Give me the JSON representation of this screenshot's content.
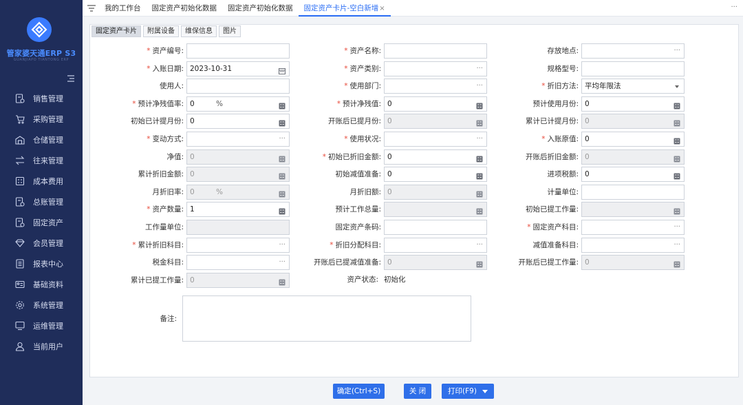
{
  "app": {
    "brand": "管家婆天通ERP S3",
    "brand_sub": "GUANJIAPO TIANTONG ERP"
  },
  "sidebar": {
    "items": [
      {
        "label": "销售管理",
        "icon": "sales-doc-icon"
      },
      {
        "label": "采购管理",
        "icon": "cart-icon"
      },
      {
        "label": "仓储管理",
        "icon": "warehouse-icon"
      },
      {
        "label": "往来管理",
        "icon": "exchange-icon"
      },
      {
        "label": "成本费用",
        "icon": "calculator-icon"
      },
      {
        "label": "总账管理",
        "icon": "ledger-icon"
      },
      {
        "label": "固定资产",
        "icon": "asset-icon"
      },
      {
        "label": "会员管理",
        "icon": "diamond-icon"
      },
      {
        "label": "报表中心",
        "icon": "report-icon"
      },
      {
        "label": "基础资料",
        "icon": "id-card-icon"
      },
      {
        "label": "系统管理",
        "icon": "gear-icon"
      },
      {
        "label": "运维管理",
        "icon": "monitor-icon"
      },
      {
        "label": "当前用户",
        "icon": "user-icon"
      }
    ]
  },
  "tabs": [
    {
      "label": "我的工作台"
    },
    {
      "label": "固定资产初始化数据"
    },
    {
      "label": "固定资产初始化数据"
    },
    {
      "label": "固定资产卡片-空白新增",
      "close": "×"
    }
  ],
  "more_label": "···",
  "subtabs": [
    "固定资产卡片",
    "附属设备",
    "维保信息",
    "图片"
  ],
  "form": {
    "fields": [
      {
        "label": "资产编号:",
        "req": "*",
        "value": ""
      },
      {
        "label": "资产名称:",
        "req": "*",
        "value": ""
      },
      {
        "label": "存放地点:",
        "value": "",
        "suffix": "···"
      },
      {
        "label": "入账日期:",
        "req": "*",
        "value": "2023-10-31",
        "icon": "calendar-icon"
      },
      {
        "label": "资产类别:",
        "req": "*",
        "value": "",
        "suffix": "···"
      },
      {
        "label": "规格型号:",
        "value": ""
      },
      {
        "label": "使用人:",
        "value": ""
      },
      {
        "label": "使用部门:",
        "req": "*",
        "value": "",
        "suffix": "···"
      },
      {
        "label": "折旧方法:",
        "req": "*",
        "value": "平均年限法",
        "dropdown": true
      },
      {
        "label": "预计净残值率:",
        "req": "*",
        "value": "0",
        "percent": "%",
        "icon": "calculator-icon"
      },
      {
        "label": "预计净残值:",
        "req": "*",
        "value": "0",
        "icon": "calculator-icon"
      },
      {
        "label": "预计使用月份:",
        "value": "0",
        "icon": "calculator-icon"
      },
      {
        "label": "初始已计提月份:",
        "value": "0",
        "icon": "calculator-icon"
      },
      {
        "label": "开账后已提月份:",
        "value": "0",
        "disabled": true,
        "icon": "calculator-icon"
      },
      {
        "label": "累计已计提月份:",
        "value": "0",
        "disabled": true,
        "icon": "calculator-icon"
      },
      {
        "label": "变动方式:",
        "req": "*",
        "value": "",
        "suffix": "···"
      },
      {
        "label": "使用状况:",
        "req": "*",
        "value": "",
        "suffix": "···"
      },
      {
        "label": "入账原值:",
        "req": "*",
        "value": "0",
        "icon": "calculator-icon"
      },
      {
        "label": "净值:",
        "value": "0",
        "disabled": true,
        "icon": "calculator-icon"
      },
      {
        "label": "初始已折旧金额:",
        "req": "*",
        "value": "0",
        "icon": "calculator-icon"
      },
      {
        "label": "开账后折旧金额:",
        "value": "0",
        "disabled": true,
        "icon": "calculator-icon"
      },
      {
        "label": "累计折旧金额:",
        "value": "0",
        "disabled": true,
        "icon": "calculator-icon"
      },
      {
        "label": "初始减值准备:",
        "value": "0",
        "icon": "calculator-icon"
      },
      {
        "label": "进项税额:",
        "value": "0",
        "icon": "calculator-icon"
      },
      {
        "label": "月折旧率:",
        "value": "0",
        "percent": "%",
        "disabled": true,
        "icon": "calculator-icon"
      },
      {
        "label": "月折旧额:",
        "value": "0",
        "disabled": true,
        "icon": "calculator-icon"
      },
      {
        "label": "计量单位:",
        "value": ""
      },
      {
        "label": "资产数量:",
        "req": "*",
        "value": "1",
        "icon": "calculator-icon"
      },
      {
        "label": "预计工作总量:",
        "value": "",
        "disabled": true,
        "icon": "calculator-icon"
      },
      {
        "label": "初始已提工作量:",
        "value": "",
        "disabled": true,
        "icon": "calculator-icon"
      },
      {
        "label": "工作量单位:",
        "value": "",
        "disabled": true
      },
      {
        "label": "固定资产条码:",
        "value": ""
      },
      {
        "label": "固定资产科目:",
        "req": "*",
        "value": "",
        "suffix": "···"
      },
      {
        "label": "累计折旧科目:",
        "req": "*",
        "value": "",
        "suffix": "···"
      },
      {
        "label": "折旧分配科目:",
        "req": "*",
        "value": "",
        "suffix": "···"
      },
      {
        "label": "减值准备科目:",
        "value": "",
        "suffix": "···"
      },
      {
        "label": "税金科目:",
        "value": "",
        "suffix": "···"
      },
      {
        "label": "开账后已提减值准备:",
        "value": "0",
        "disabled": true,
        "icon": "calculator-icon"
      },
      {
        "label": "开账后已提工作量:",
        "value": "0",
        "disabled": true,
        "icon": "calculator-icon"
      },
      {
        "label": "累计已提工作量:",
        "value": "0",
        "disabled": true,
        "icon": "calculator-icon"
      }
    ],
    "status_label": "资产状态:",
    "status_value": "初始化",
    "remark_label": "备注:"
  },
  "buttons": {
    "confirm": "确定(Ctrl+S)",
    "close": "关 闭",
    "print": "打印(F9)"
  },
  "colors": {
    "sidebar_bg": "#1f2d5a",
    "accent": "#2f6fe9",
    "required": "#e84b3c"
  }
}
